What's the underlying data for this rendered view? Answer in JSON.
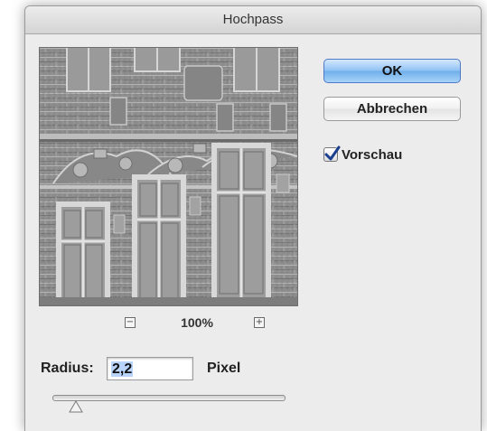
{
  "window": {
    "title": "Hochpass"
  },
  "buttons": {
    "ok_label": "OK",
    "cancel_label": "Abbrechen"
  },
  "preview": {
    "checkbox_label": "Vorschau",
    "checked": true,
    "zoom_label": "100%"
  },
  "radius": {
    "label": "Radius:",
    "value": "2,2",
    "unit": "Pixel",
    "slider_fraction": 0.1
  },
  "icons": {
    "zoom_out": "zoom-out-icon",
    "zoom_in": "zoom-in-icon",
    "check": "checkmark-icon"
  },
  "colors": {
    "ok_button": "#8fc1f4",
    "dialog_bg": "#ececec",
    "selection": "#b8d4fb",
    "check": "#1a3f8f"
  }
}
